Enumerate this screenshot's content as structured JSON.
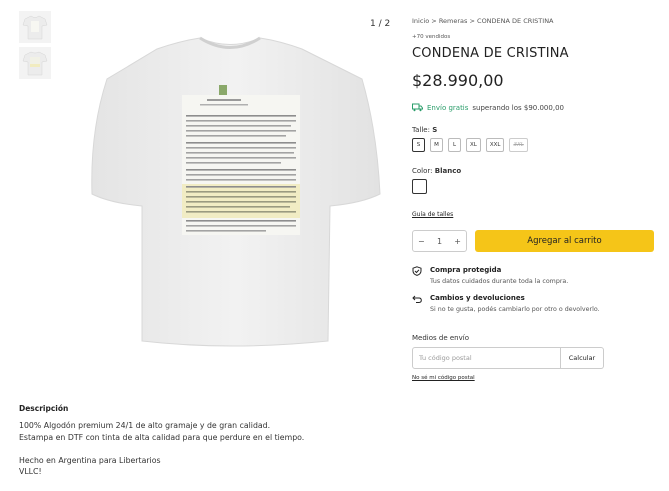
{
  "gallery": {
    "counter": "1 / 2",
    "thumbnails": [
      "thumb-front",
      "thumb-back"
    ]
  },
  "breadcrumb": {
    "items": [
      "Inicio",
      "Remeras",
      "CONDENA DE CRISTINA"
    ],
    "separator": ">"
  },
  "product": {
    "sold": "+70 vendidos",
    "title": "CONDENA DE CRISTINA",
    "price": "$28.990,00",
    "shipping_free": "Envío gratis",
    "shipping_rest": "superando los $90.000,00",
    "size_label": "Talle:",
    "size_selected": "S",
    "sizes": [
      "S",
      "M",
      "L",
      "XL",
      "XXL",
      "3XL"
    ],
    "color_label": "Color:",
    "color_selected": "Blanco",
    "size_guide": "Guía de talles",
    "quantity": "1",
    "add_to_cart": "Agregar al carrito"
  },
  "benefits": [
    {
      "icon": "shield-icon",
      "title": "Compra protegida",
      "subtitle": "Tus datos cuidados durante toda la compra."
    },
    {
      "icon": "return-arrow-icon",
      "title": "Cambios y devoluciones",
      "subtitle": "Si no te gusta, podés cambiarlo por otro o devolverlo."
    }
  ],
  "shipping_calc": {
    "label": "Medios de envío",
    "placeholder": "Tu código postal",
    "button": "Calcular",
    "no_zip": "No sé mi código postal"
  },
  "description": {
    "title": "Descripción",
    "lines": [
      "100% Algodón premium 24/1 de alto gramaje y de gran calidad.",
      "Estampa en DTF con tinta de alta calidad para que perdure en el tiempo.",
      "",
      "Hecho en Argentina para Libertarios",
      "VLLC!"
    ]
  },
  "colors": {
    "accent": "#f5c518",
    "free_shipping": "#2a9d6a"
  }
}
